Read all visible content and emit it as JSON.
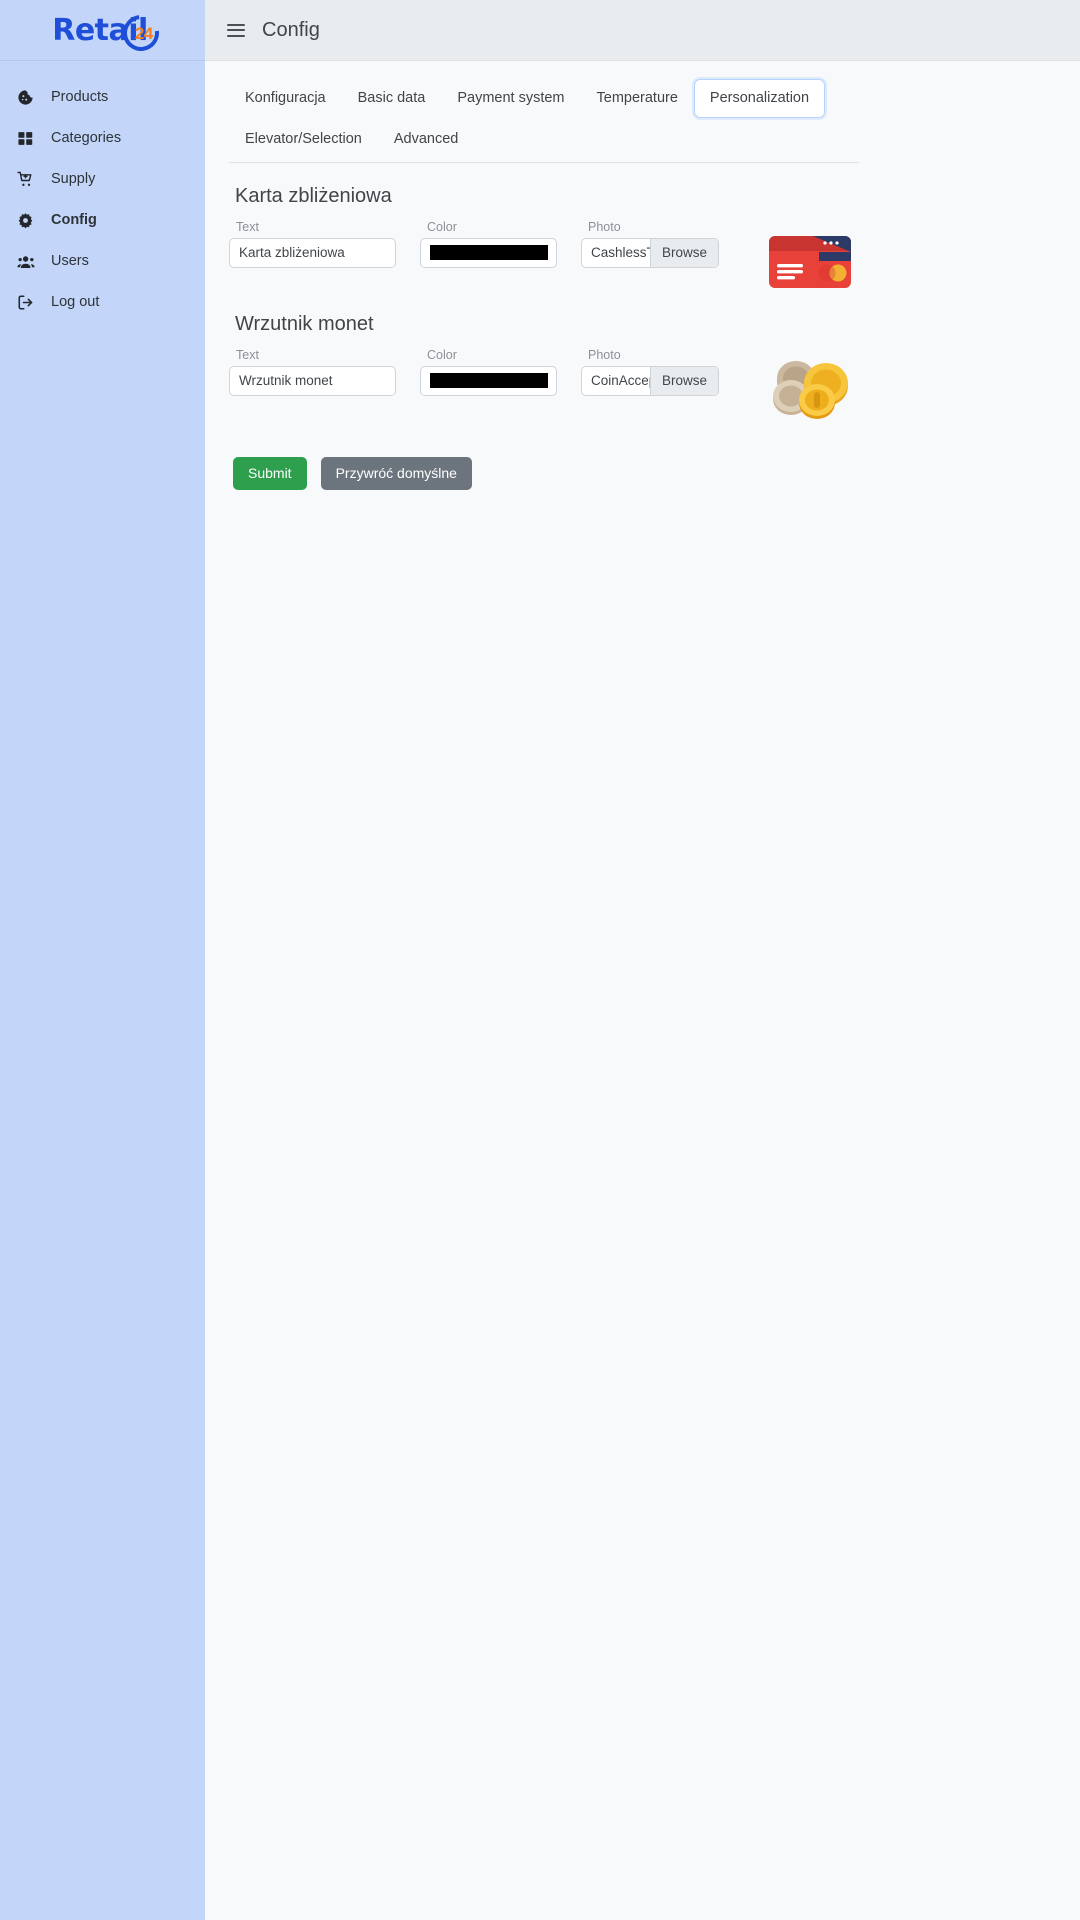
{
  "brand": {
    "name": "Retail",
    "badge": "24",
    "primary_color": "#1f4fd8",
    "accent_color": "#f77f1b"
  },
  "sidebar": {
    "items": [
      {
        "label": "Products",
        "icon": "cookie-icon",
        "active": false
      },
      {
        "label": "Categories",
        "icon": "grid-icon",
        "active": false
      },
      {
        "label": "Supply",
        "icon": "cart-icon",
        "active": false
      },
      {
        "label": "Config",
        "icon": "gear-icon",
        "active": true
      },
      {
        "label": "Users",
        "icon": "users-icon",
        "active": false
      },
      {
        "label": "Log out",
        "icon": "sign-out-icon",
        "active": false
      }
    ]
  },
  "header": {
    "menu_icon": "hamburger-icon",
    "title": "Config"
  },
  "tabs": [
    {
      "label": "Konfiguracja",
      "active": false
    },
    {
      "label": "Basic data",
      "active": false
    },
    {
      "label": "Payment system",
      "active": false
    },
    {
      "label": "Temperature",
      "active": false
    },
    {
      "label": "Personalization",
      "active": true
    },
    {
      "label": "Elevator/Selection",
      "active": false
    },
    {
      "label": "Advanced",
      "active": false
    }
  ],
  "labels": {
    "text": "Text",
    "color": "Color",
    "photo": "Photo",
    "browse": "Browse"
  },
  "sections": [
    {
      "title": "Karta zbliżeniowa",
      "text_value": "Karta zbliżeniowa",
      "text_placeholder": "Text",
      "color_value": "#000000",
      "file_name": "CashlessTe",
      "preview_icon": "credit-card-image"
    },
    {
      "title": "Wrzutnik monet",
      "text_value": "Wrzutnik monet",
      "text_placeholder": "Text",
      "color_value": "#000000",
      "file_name": "CoinAccep",
      "preview_icon": "coins-image"
    }
  ],
  "actions": {
    "submit_label": "Submit",
    "restore_label": "Przywróć domyślne",
    "submit_color": "#2d9f4d",
    "restore_color": "#6c757d"
  }
}
